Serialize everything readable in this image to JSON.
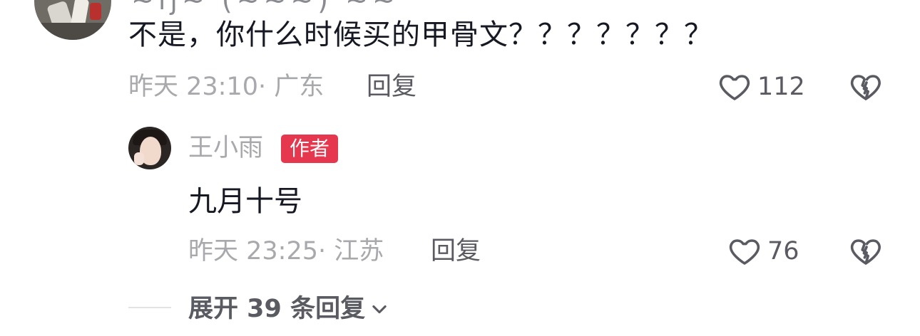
{
  "parent_comment": {
    "cut_off_username": "~ij~ (~~~) ~~",
    "text": "不是，你什么时候买的甲骨文？？？？？？？",
    "time": "昨天 23:10· 广东",
    "reply_label": "回复",
    "like_count": "112"
  },
  "reply": {
    "username": "王小雨",
    "author_badge": "作者",
    "text": "九月十号",
    "time": "昨天 23:25· 江苏",
    "reply_label": "回复",
    "like_count": "76"
  },
  "expand": {
    "label": "展开 39 条回复"
  },
  "icons": {
    "like": "heart-outline-icon",
    "dislike": "broken-heart-icon",
    "expand": "chevron-down-icon"
  },
  "colors": {
    "text_primary": "#161823",
    "text_secondary": "#a8a9ad",
    "text_action": "#5a5b62",
    "author_badge": "#e5384f"
  }
}
